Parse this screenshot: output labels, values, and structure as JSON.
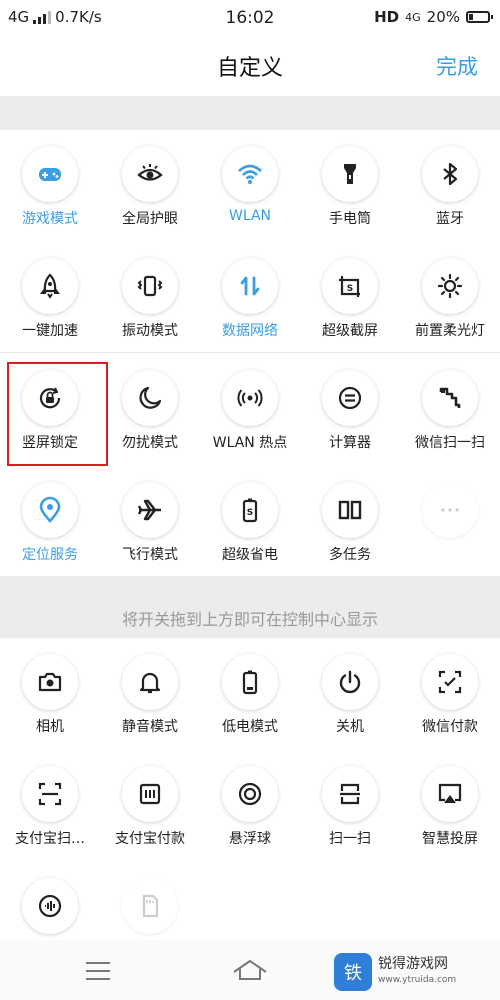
{
  "status": {
    "network": "4G",
    "speed": "0.7K/s",
    "time": "16:02",
    "hd": "HD",
    "net2": "4G",
    "battery": "20%",
    "battery_level": 0.2
  },
  "header": {
    "title": "自定义",
    "done": "完成"
  },
  "colors": {
    "accent": "#3a9ee6",
    "highlight": "#d81e1e"
  },
  "active_tiles": [
    {
      "label": "游戏模式",
      "icon": "gamepad-icon"
    },
    {
      "label": "全局护眼",
      "icon": "eye-icon"
    },
    {
      "label": "WLAN",
      "icon": "wifi-icon"
    },
    {
      "label": "手电筒",
      "icon": "flashlight-icon"
    },
    {
      "label": "蓝牙",
      "icon": "bluetooth-icon"
    },
    {
      "label": "一键加速",
      "icon": "rocket-icon"
    },
    {
      "label": "振动模式",
      "icon": "vibrate-icon"
    },
    {
      "label": "数据网络",
      "icon": "data-arrows-icon"
    },
    {
      "label": "超级截屏",
      "icon": "screenshot-icon"
    },
    {
      "label": "前置柔光灯",
      "icon": "sun-icon"
    },
    {
      "label": "竖屏锁定",
      "icon": "rotation-lock-icon"
    },
    {
      "label": "勿扰模式",
      "icon": "moon-icon"
    },
    {
      "label": "WLAN 热点",
      "icon": "hotspot-icon"
    },
    {
      "label": "计算器",
      "icon": "calculator-icon"
    },
    {
      "label": "微信扫一扫",
      "icon": "wechat-scan-icon"
    },
    {
      "label": "定位服务",
      "icon": "location-icon"
    },
    {
      "label": "飞行模式",
      "icon": "airplane-icon"
    },
    {
      "label": "超级省电",
      "icon": "battery-saver-icon"
    },
    {
      "label": "多任务",
      "icon": "multitask-icon"
    }
  ],
  "hint": "将开关拖到上方即可在控制中心显示",
  "inactive_tiles": [
    {
      "label": "相机",
      "icon": "camera-icon"
    },
    {
      "label": "静音模式",
      "icon": "bell-icon"
    },
    {
      "label": "低电模式",
      "icon": "low-battery-icon"
    },
    {
      "label": "关机",
      "icon": "power-icon"
    },
    {
      "label": "微信付款",
      "icon": "wechat-pay-icon"
    },
    {
      "label": "支付宝扫…",
      "icon": "alipay-scan-icon"
    },
    {
      "label": "支付宝付款",
      "icon": "alipay-pay-icon"
    },
    {
      "label": "悬浮球",
      "icon": "floating-ball-icon"
    },
    {
      "label": "扫一扫",
      "icon": "scan-icon"
    },
    {
      "label": "智慧投屏",
      "icon": "cast-icon"
    }
  ],
  "watermark": {
    "logo": "铁",
    "name": "锐得游戏网",
    "url": "www.ytruida.com"
  }
}
